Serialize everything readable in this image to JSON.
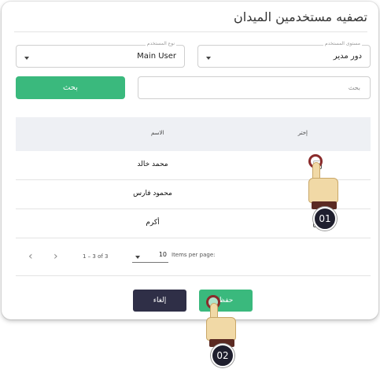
{
  "dialog": {
    "title": "تصفيه مستخدمين الميدان"
  },
  "filters": {
    "role": {
      "label": "مستوى المستخدم",
      "value": "دور مدير"
    },
    "user": {
      "label": "نوع المستخدم",
      "value": "Main User"
    },
    "search_placeholder": "بحث",
    "search_button": "بحث"
  },
  "table": {
    "headers": {
      "select": "إختر",
      "name": "الاسم"
    },
    "rows": [
      {
        "name": "محمد خالد"
      },
      {
        "name": "محمود فارس"
      },
      {
        "name": "أكرم"
      }
    ]
  },
  "pagination": {
    "range": "1 – 3 of 3",
    "page_size": "10",
    "per_page_label": "Items per page:"
  },
  "footer": {
    "cancel": "إلغاء",
    "save": "حفظ"
  },
  "annotations": {
    "step1": "01",
    "step2": "02"
  },
  "colors": {
    "accent_green": "#3ab97d",
    "dark_button": "#2f2f47",
    "header_row": "#eef0f4"
  },
  "icons": [
    "chevron-down-icon",
    "chevron-left-icon",
    "chevron-right-icon",
    "pointer-hand-icon"
  ]
}
